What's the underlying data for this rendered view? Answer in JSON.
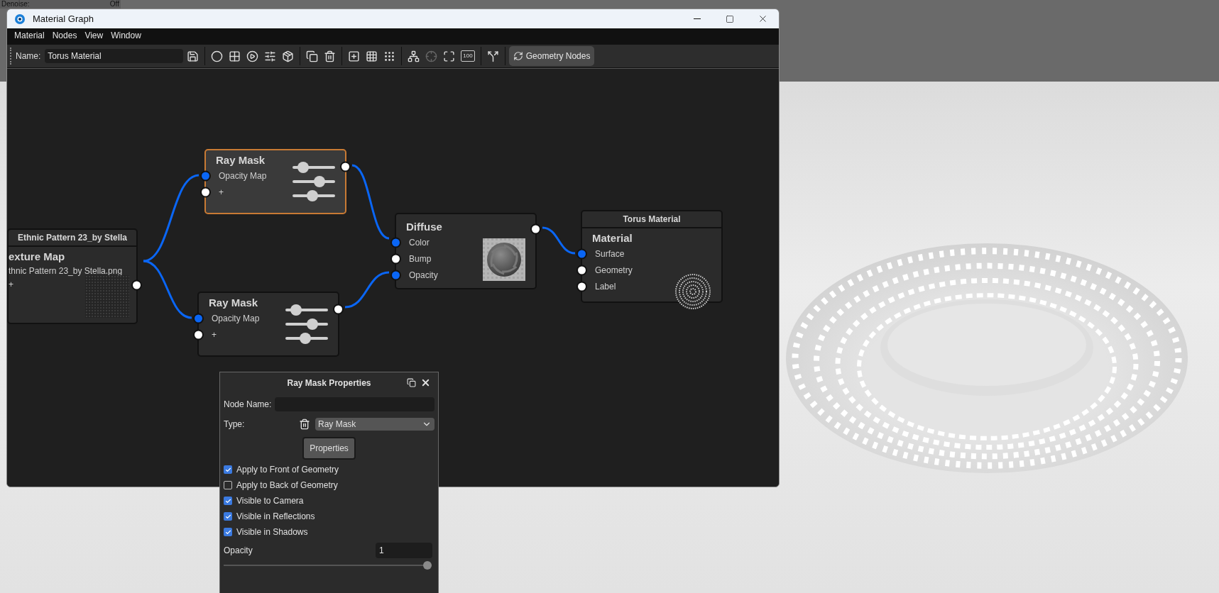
{
  "background_panel": {
    "label": "Denoise:",
    "value": "Off"
  },
  "window": {
    "title": "Material Graph"
  },
  "menu": [
    "Material",
    "Nodes",
    "View",
    "Window"
  ],
  "toolbar": {
    "name_label": "Name:",
    "name_value": "Torus Material",
    "zoom_label": "100",
    "mode_button": "Geometry Nodes"
  },
  "nodes": [
    {
      "kind": "texture",
      "selected": false,
      "header": "Ethnic Pattern 23_by Stella",
      "title": "exture Map",
      "file": "thnic Pattern 23_by Stella.png",
      "add_label": "+"
    },
    {
      "kind": "ray_mask",
      "selected": true,
      "title": "Ray Mask",
      "inputs": [
        {
          "label": "Opacity Map",
          "connected": true
        },
        {
          "label": "+",
          "connected": false
        }
      ]
    },
    {
      "kind": "ray_mask",
      "selected": false,
      "title": "Ray Mask",
      "inputs": [
        {
          "label": "Opacity Map",
          "connected": true
        },
        {
          "label": "+",
          "connected": false
        }
      ]
    },
    {
      "kind": "diffuse",
      "selected": false,
      "title": "Diffuse",
      "inputs": [
        {
          "label": "Color",
          "connected": true
        },
        {
          "label": "Bump",
          "connected": false
        },
        {
          "label": "Opacity",
          "connected": true
        }
      ]
    },
    {
      "kind": "material",
      "selected": false,
      "header": "Torus Material",
      "title": "Material",
      "inputs": [
        {
          "label": "Surface",
          "connected": true
        },
        {
          "label": "Geometry",
          "connected": false
        },
        {
          "label": "Label",
          "connected": false
        }
      ]
    }
  ],
  "properties_panel": {
    "title": "Ray Mask Properties",
    "node_name_label": "Node Name:",
    "type_label": "Type:",
    "type_value": "Ray Mask",
    "properties_button": "Properties",
    "options": [
      {
        "label": "Apply to Front of Geometry",
        "checked": true
      },
      {
        "label": "Apply to Back of Geometry",
        "checked": false
      },
      {
        "label": "Visible to Camera",
        "checked": true
      },
      {
        "label": "Visible in Reflections",
        "checked": true
      },
      {
        "label": "Visible in Shadows",
        "checked": true
      }
    ],
    "opacity": {
      "label": "Opacity",
      "value": "1",
      "level": 1
    }
  }
}
